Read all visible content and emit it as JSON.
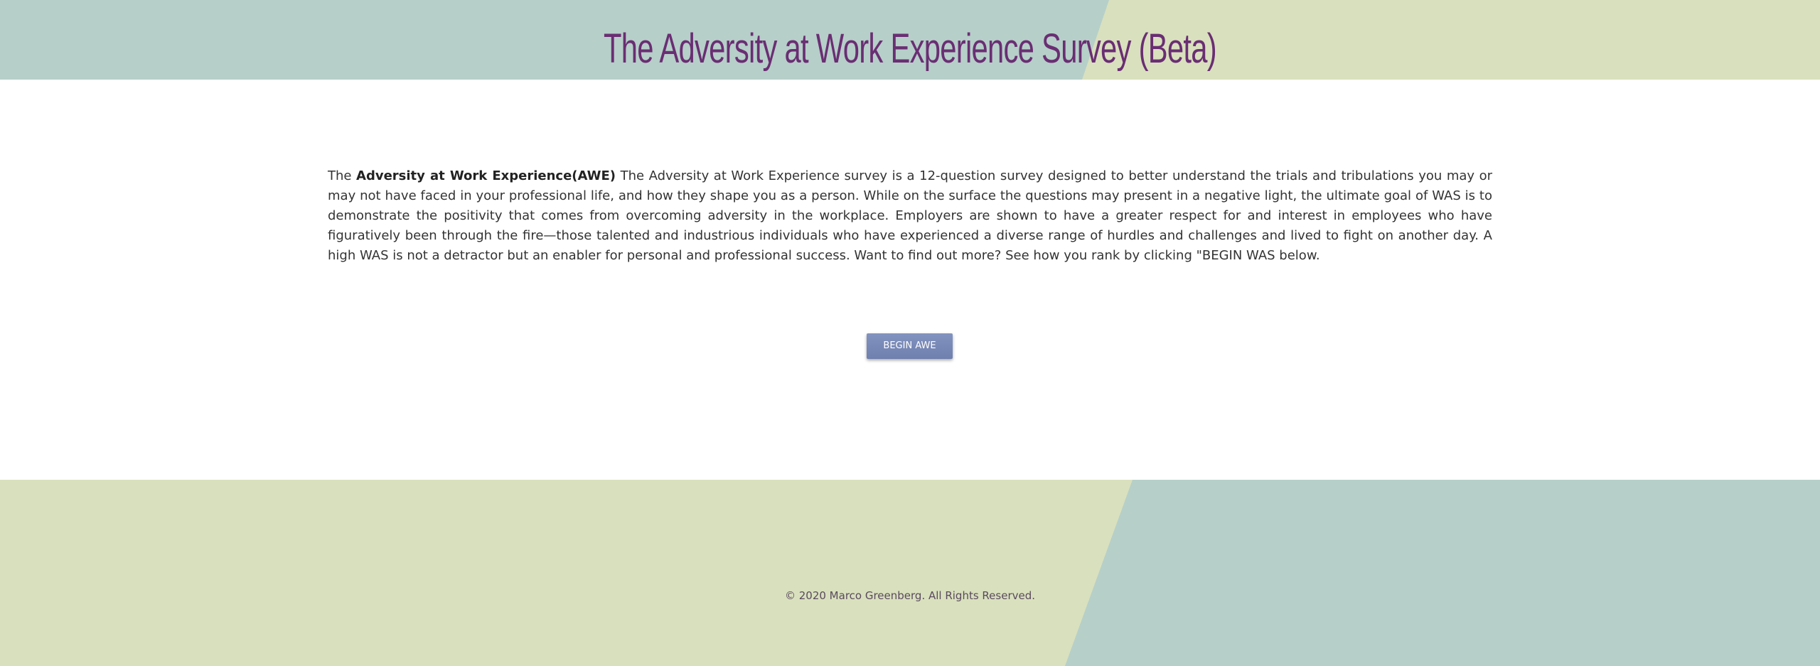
{
  "header": {
    "title": "The Adversity at Work Experience Survey (Beta)"
  },
  "intro": {
    "lead": "The ",
    "bold": "Adversity at Work Experience(AWE)",
    "body": " The Adversity at Work Experience survey is a 12-question survey designed to better understand the trials and tribulations you may or may not have faced in your professional life, and how they shape you as a person. While on the surface the questions may present in a negative light, the ultimate goal of WAS is to demonstrate the positivity that comes from overcoming adversity in the workplace. Employers are shown to have a greater respect for and interest in employees who have figuratively been through the fire—those talented and industrious individuals who have experienced a diverse range of hurdles and challenges and lived to fight on another day. A high WAS is not a detractor but an enabler for personal and professional success. Want to find out more? See how you rank by clicking \"BEGIN WAS below."
  },
  "actions": {
    "begin_label": "BEGIN AWE"
  },
  "footer": {
    "copyright": "© 2020 Marco Greenberg. All Rights Reserved."
  },
  "colors": {
    "sage": "#b6cfc9",
    "olive": "#d9e0bd",
    "title": "#6a2e73",
    "button": "#7888b8"
  }
}
